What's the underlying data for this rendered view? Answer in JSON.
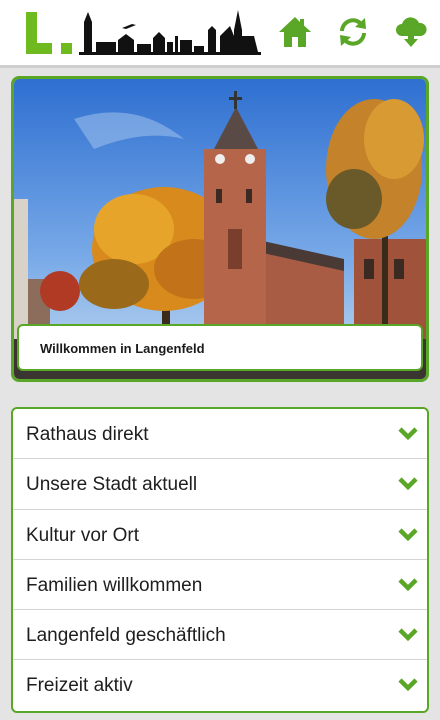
{
  "header": {
    "logo": {
      "letter": "L",
      "icon": "city-skyline-logo"
    },
    "buttons": [
      {
        "icon": "home-icon"
      },
      {
        "icon": "refresh-icon"
      },
      {
        "icon": "cloud-download-icon"
      }
    ]
  },
  "hero": {
    "image": "church-in-autumn-photo",
    "caption": "Willkommen in Langenfeld"
  },
  "menu": {
    "items": [
      {
        "label": "Rathaus direkt",
        "icon": "chevron-down-icon"
      },
      {
        "label": "Unsere Stadt aktuell",
        "icon": "chevron-down-icon"
      },
      {
        "label": "Kultur vor Ort",
        "icon": "chevron-down-icon"
      },
      {
        "label": "Familien willkommen",
        "icon": "chevron-down-icon"
      },
      {
        "label": "Langenfeld geschäftlich",
        "icon": "chevron-down-icon"
      },
      {
        "label": "Freizeit aktiv",
        "icon": "chevron-down-icon"
      }
    ]
  },
  "colors": {
    "accent": "#5aa626",
    "logo_green": "#6fbb1f",
    "header_bg": "#ffffff",
    "page_bg": "#e4e4e4"
  }
}
